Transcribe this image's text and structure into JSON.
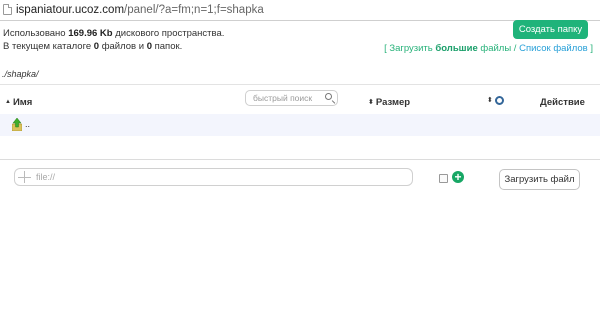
{
  "browser": {
    "url_host": "ispaniatour.ucoz.com",
    "url_path": "/panel/?a=fm;n=1;f=shapka"
  },
  "header": {
    "usage_prefix": "Использовано",
    "usage_amount": "169.96 Kb",
    "usage_suffix": "дискового пространства.",
    "catalog_prefix": "В текущем каталоге",
    "files_count": "0",
    "files_label": "файлов и",
    "folders_count": "0",
    "folders_label": "папок.",
    "create_folder_label": "Создать папку",
    "bracket_open": "[",
    "bracket_close": "]",
    "upload_pre": "Загрузить",
    "upload_big": "большие",
    "upload_post": "файлы",
    "slash": "/",
    "file_list_label": "Список файлов"
  },
  "breadcrumb": {
    "path": "./shapka/"
  },
  "table": {
    "col_name": "Имя",
    "search_placeholder": "быстрый поиск",
    "col_size": "Размер",
    "col_action": "Действие",
    "rows": [
      {
        "name": ".."
      }
    ]
  },
  "upload": {
    "file_placeholder": "file://",
    "upload_button_label": "Загрузить файл"
  },
  "colors": {
    "accent_green": "#1fb37a",
    "link_blue": "#28a0d8",
    "row_highlight": "#f3f5fd"
  }
}
